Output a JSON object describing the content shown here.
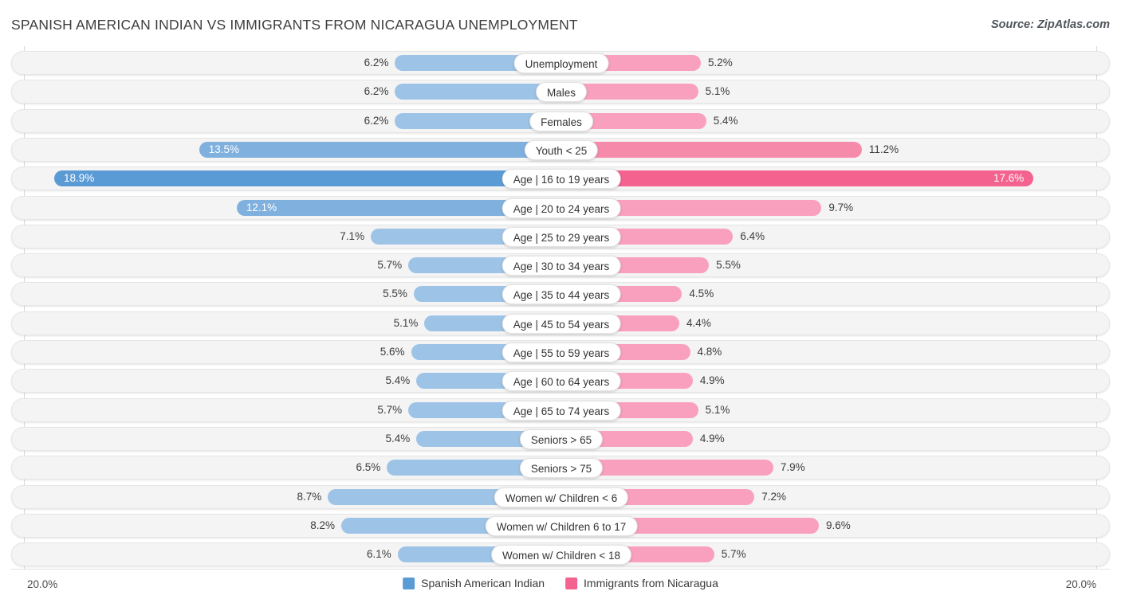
{
  "header": {
    "title": "SPANISH AMERICAN INDIAN VS IMMIGRANTS FROM NICARAGUA UNEMPLOYMENT",
    "source": "Source: ZipAtlas.com"
  },
  "footer": {
    "axis_left": "20.0%",
    "axis_right": "20.0%",
    "legend": [
      {
        "label": "Spanish American Indian",
        "color": "#5b9bd5"
      },
      {
        "label": "Immigrants from Nicaragua",
        "color": "#f4628f"
      }
    ]
  },
  "colors": {
    "left_light": "#9dc3e6",
    "left_mid": "#7fb0de",
    "left_dark": "#5b9bd5",
    "right_light": "#f8a0bd",
    "right_mid": "#f68aab",
    "right_dark": "#f4628f",
    "row_bg": "#f4f4f4",
    "gridline": "#d8d8d8"
  },
  "chart_data": {
    "type": "bar",
    "subtype": "diverging-bidirectional",
    "title": "SPANISH AMERICAN INDIAN VS IMMIGRANTS FROM NICARAGUA UNEMPLOYMENT",
    "xlabel": "",
    "ylabel": "",
    "xlim": [
      20.0,
      20.0
    ],
    "axis_max": 20.0,
    "unit": "%",
    "grid": true,
    "legend_position": "bottom-center",
    "categories": [
      "Unemployment",
      "Males",
      "Females",
      "Youth < 25",
      "Age | 16 to 19 years",
      "Age | 20 to 24 years",
      "Age | 25 to 29 years",
      "Age | 30 to 34 years",
      "Age | 35 to 44 years",
      "Age | 45 to 54 years",
      "Age | 55 to 59 years",
      "Age | 60 to 64 years",
      "Age | 65 to 74 years",
      "Seniors > 65",
      "Seniors > 75",
      "Women w/ Children < 6",
      "Women w/ Children 6 to 17",
      "Women w/ Children < 18"
    ],
    "series": [
      {
        "name": "Spanish American Indian",
        "side": "left",
        "color": "#5b9bd5",
        "values": [
          6.2,
          6.2,
          6.2,
          13.5,
          18.9,
          12.1,
          7.1,
          5.7,
          5.5,
          5.1,
          5.6,
          5.4,
          5.7,
          5.4,
          6.5,
          8.7,
          8.2,
          6.1
        ],
        "labels": [
          "6.2%",
          "6.2%",
          "6.2%",
          "13.5%",
          "18.9%",
          "12.1%",
          "7.1%",
          "5.7%",
          "5.5%",
          "5.1%",
          "5.6%",
          "5.4%",
          "5.7%",
          "5.4%",
          "6.5%",
          "8.7%",
          "8.2%",
          "6.1%"
        ]
      },
      {
        "name": "Immigrants from Nicaragua",
        "side": "right",
        "color": "#f4628f",
        "values": [
          5.2,
          5.1,
          5.4,
          11.2,
          17.6,
          9.7,
          6.4,
          5.5,
          4.5,
          4.4,
          4.8,
          4.9,
          5.1,
          4.9,
          7.9,
          7.2,
          9.6,
          5.7
        ],
        "labels": [
          "5.2%",
          "5.1%",
          "5.4%",
          "11.2%",
          "17.6%",
          "9.7%",
          "6.4%",
          "5.5%",
          "4.5%",
          "4.4%",
          "4.8%",
          "4.9%",
          "5.1%",
          "4.9%",
          "7.9%",
          "7.2%",
          "9.6%",
          "5.7%"
        ]
      }
    ]
  }
}
